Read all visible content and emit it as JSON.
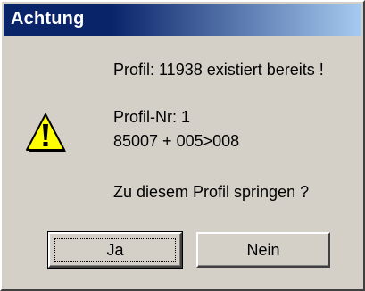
{
  "dialog": {
    "title": "Achtung",
    "icon": "warning-icon",
    "messages": [
      "Profil: 11938 existiert bereits !",
      "Profil-Nr: 1",
      "85007 + 005>008",
      "Zu diesem Profil springen ?"
    ],
    "buttons": {
      "yes_label": "Ja",
      "no_label": "Nein"
    }
  },
  "colors": {
    "titlebar_start": "#0a246a",
    "titlebar_end": "#a6caf0",
    "face": "#d4d0c8",
    "warning_yellow": "#ffff00"
  }
}
